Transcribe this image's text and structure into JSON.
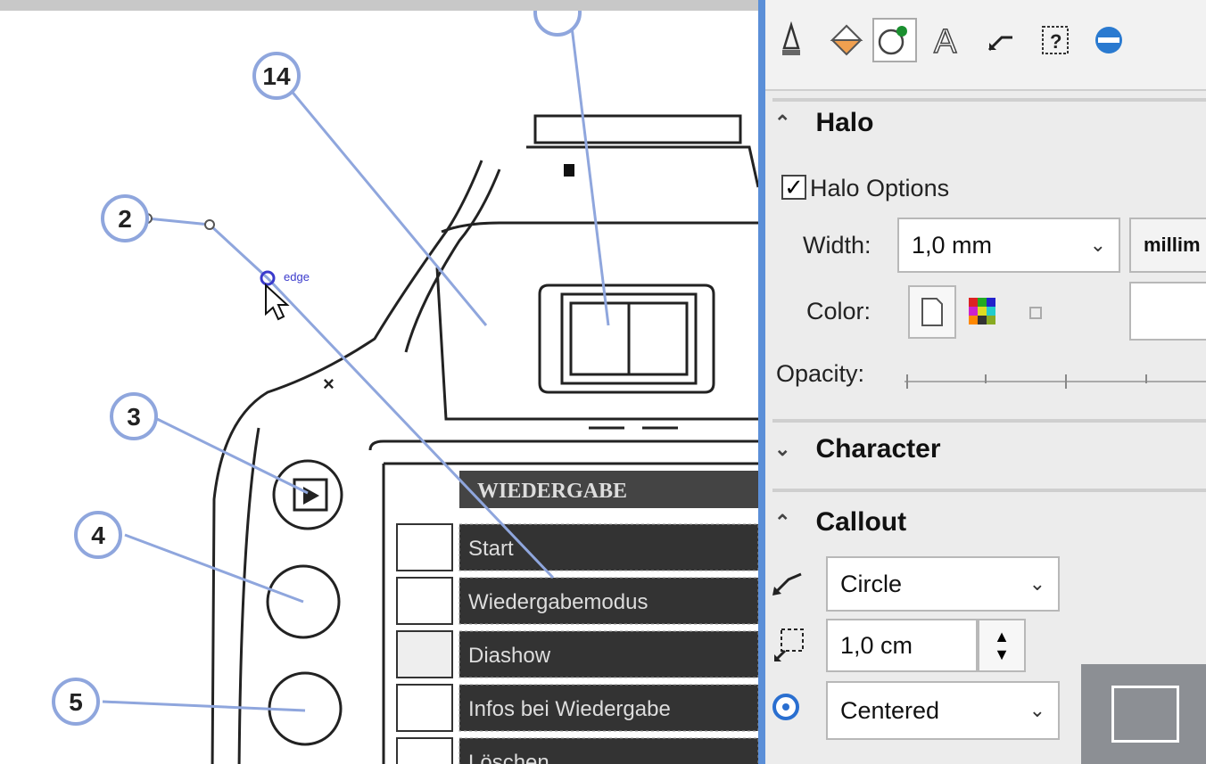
{
  "toolbar": {
    "tabs": [
      {
        "name": "outline-pen-icon",
        "glyph": "✎"
      },
      {
        "name": "fill-icon",
        "glyph": "◈"
      },
      {
        "name": "object-style-icon",
        "glyph": "◔"
      },
      {
        "name": "character-icon",
        "glyph": "A"
      },
      {
        "name": "connector-icon",
        "glyph": "⟋"
      },
      {
        "name": "summary-icon",
        "glyph": "?"
      },
      {
        "name": "transparency-icon",
        "glyph": "●"
      }
    ]
  },
  "halo": {
    "title": "Halo",
    "options_label": "Halo Options",
    "options_checked": true,
    "width_label": "Width:",
    "width_value": "1,0 mm",
    "units_value": "millim",
    "color_label": "Color:",
    "opacity_label": "Opacity:"
  },
  "character": {
    "title": "Character"
  },
  "callout": {
    "title": "Callout",
    "shape_value": "Circle",
    "size_value": "1,0 cm",
    "alignment_value": "Centered"
  },
  "canvas": {
    "callouts": [
      "14",
      "2",
      "3",
      "4",
      "5"
    ],
    "menu_title": "WIEDERGABE",
    "menu_items": [
      "Start",
      "Wiedergabemodus",
      "Diashow",
      "Infos bei Wiedergabe",
      "Löschen"
    ],
    "cursor_hint": "edge"
  },
  "colors": {
    "accent": "#5b8fd8",
    "callout_line": "#8fa6dd",
    "panel": "#ececec"
  }
}
